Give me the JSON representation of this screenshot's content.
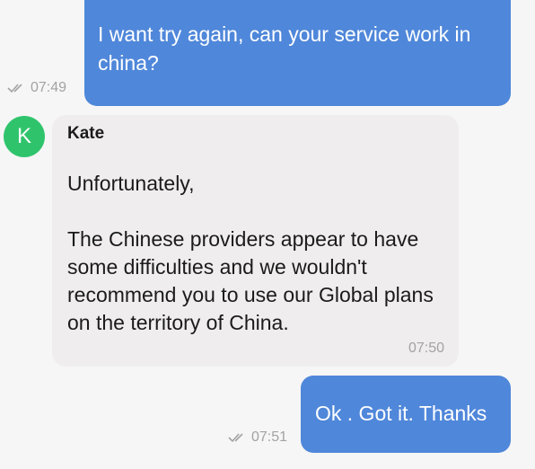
{
  "messages": {
    "outgoing_1": {
      "text": "I want try again, can your service work in china?",
      "time": "07:49",
      "status_icon": "double-check-icon"
    },
    "incoming_1": {
      "avatar_letter": "K",
      "sender": "Kate",
      "paragraphs": [
        "Unfortunately,",
        "The Chinese providers appear to have some difficulties and we wouldn't recommend you to use our Global plans on the territory of China."
      ],
      "time": "07:50"
    },
    "outgoing_2": {
      "text": "Ok . Got it. Thanks",
      "time": "07:51",
      "status_icon": "double-check-icon"
    }
  },
  "colors": {
    "background": "#f7f6f6",
    "outgoing_bubble": "#4f87da",
    "incoming_bubble": "#efeded",
    "avatar": "#2fc46c",
    "meta_text": "#a3a3a3"
  }
}
